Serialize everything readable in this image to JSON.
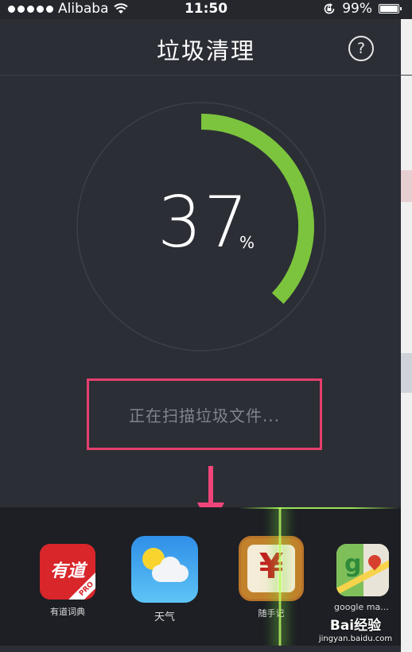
{
  "status_bar": {
    "carrier": "Alibaba",
    "time": "11:50",
    "battery": "99%"
  },
  "header": {
    "title": "垃圾清理",
    "help_icon": "?"
  },
  "scan": {
    "progress_value": "37",
    "progress_unit": "%",
    "progress_fraction": 0.37,
    "status_text": "正在扫描垃圾文件..."
  },
  "apps": [
    {
      "label": "有道词典",
      "icon_text": "有道",
      "badge": "PRO",
      "icon": "youdao-dict-icon"
    },
    {
      "label": "天气",
      "icon": "weather-icon"
    },
    {
      "label": "随手记",
      "icon_text": "¥",
      "icon": "suishouji-icon"
    },
    {
      "label": "google ma...",
      "icon": "google-maps-icon"
    }
  ],
  "watermark": {
    "brand": "Bai经验",
    "url": "jingyan.baidu.com"
  },
  "colors": {
    "background": "#2b2e35",
    "progress": "#7cc43d",
    "highlight_box": "#e53f6e",
    "arrow": "#f0457a",
    "scan_line": "#b6ff5c"
  }
}
